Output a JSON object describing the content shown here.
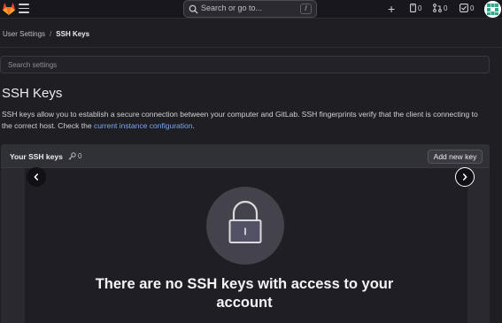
{
  "header": {
    "search_placeholder": "Search or go to...",
    "search_shortcut": "/",
    "issues_count": "0",
    "merge_requests_count": "0",
    "todos_count": "0"
  },
  "breadcrumb": {
    "parent": "User Settings",
    "separator": "/",
    "current": "SSH Keys"
  },
  "settings_search": {
    "placeholder": "Search settings"
  },
  "page": {
    "title": "SSH Keys",
    "description_text": "SSH keys allow you to establish a secure connection between your computer and GitLab. SSH fingerprints verify that the client is connecting to the correct host. Check the ",
    "description_link": "current instance configuration",
    "description_end": "."
  },
  "card": {
    "title": "Your SSH keys",
    "key_count": "0",
    "add_button_label": "Add new key",
    "empty_state_title": "There are no SSH keys with access to your account"
  },
  "colors": {
    "background": "#1f1f23",
    "link": "#7aa5f3",
    "logo_orange": "#e24329"
  },
  "icons": [
    "gitlab-logo",
    "menu-icon",
    "search-icon",
    "plus-icon",
    "issues-icon",
    "merge-request-icon",
    "todo-icon",
    "avatar",
    "key-icon",
    "chevron-left-icon",
    "chevron-right-icon",
    "lock-icon"
  ]
}
